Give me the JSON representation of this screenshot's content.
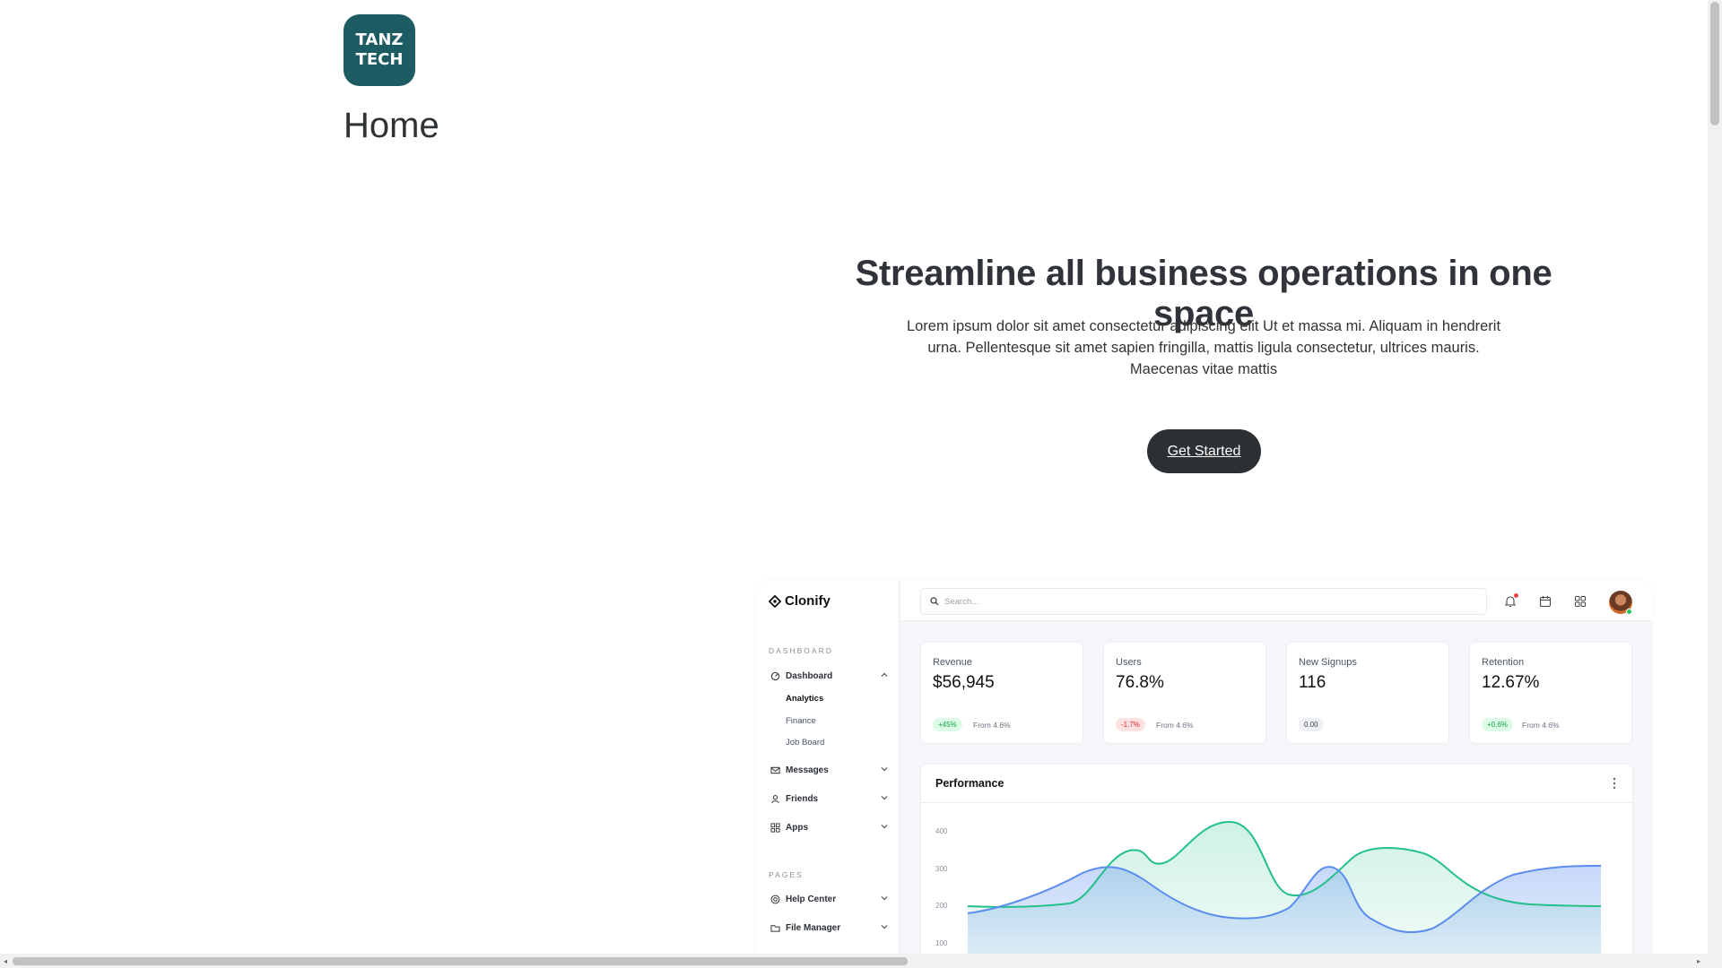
{
  "header": {
    "logo_line1": "TANZ",
    "logo_line2": "TECH",
    "title": "Home"
  },
  "hero": {
    "title": "Streamline all business operations in one space",
    "text": "Lorem ipsum dolor sit amet consectetur adipiscing elit Ut et massa mi. Aliquam in hendrerit urna. Pellentesque sit amet sapien fringilla, mattis ligula consectetur, ultrices mauris. Maecenas vitae mattis",
    "cta_label": "Get Started"
  },
  "dashboard": {
    "brand": "Clonify",
    "search_placeholder": "Search...",
    "sections": {
      "dashboard": "DASHBOARD",
      "pages": "PAGES"
    },
    "nav": {
      "dashboard": "Dashboard",
      "sub": [
        "Analytics",
        "Finance",
        "Job Board"
      ],
      "messages": "Messages",
      "friends": "Friends",
      "apps": "Apps",
      "help_center": "Help Center",
      "file_manager": "File Manager"
    },
    "stats": [
      {
        "label": "Revenue",
        "value": "$56,945",
        "badge": "+45%",
        "from": "From 4.6%"
      },
      {
        "label": "Users",
        "value": "76.8%",
        "badge": "-1.7%",
        "from": "From 4.6%"
      },
      {
        "label": "New Signups",
        "value": "116",
        "badge": "0.00",
        "from": ""
      },
      {
        "label": "Retention",
        "value": "12.67%",
        "badge": "+0.6%",
        "from": "From 4.6%"
      }
    ],
    "performance": {
      "title": "Performance",
      "y_ticks": [
        "400",
        "300",
        "200",
        "100"
      ]
    }
  },
  "colors": {
    "brand": "#1d5c63",
    "cta": "#2d3033",
    "green": "#22c08a",
    "blue": "#5b8def"
  }
}
